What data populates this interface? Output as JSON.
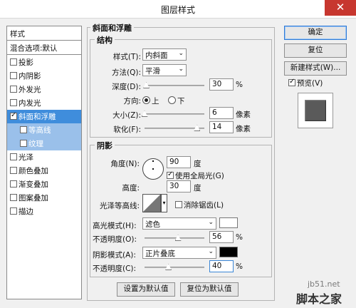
{
  "window": {
    "title": "图层样式",
    "close": "✕"
  },
  "style_list": {
    "header": "样式",
    "blend_options": "混合选项:默认",
    "items": [
      {
        "label": "投影",
        "checked": false
      },
      {
        "label": "内阴影",
        "checked": false
      },
      {
        "label": "外发光",
        "checked": false
      },
      {
        "label": "内发光",
        "checked": false
      },
      {
        "label": "斜面和浮雕",
        "checked": true
      },
      {
        "label": "等高线",
        "checked": false
      },
      {
        "label": "纹理",
        "checked": false
      },
      {
        "label": "光泽",
        "checked": false
      },
      {
        "label": "颜色叠加",
        "checked": false
      },
      {
        "label": "渐变叠加",
        "checked": false
      },
      {
        "label": "图案叠加",
        "checked": false
      },
      {
        "label": "描边",
        "checked": false
      }
    ]
  },
  "bevel": {
    "legend": "斜面和浮雕",
    "structure": {
      "legend": "结构",
      "style_label": "样式(T):",
      "style_value": "内斜面",
      "technique_label": "方法(Q):",
      "technique_value": "平滑",
      "depth_label": "深度(D):",
      "depth_value": "30",
      "depth_unit": "%",
      "depth_level": 0.03,
      "direction_label": "方向:",
      "direction_up": "上",
      "direction_down": "下",
      "direction_selected": "up",
      "size_label": "大小(Z):",
      "size_value": "6",
      "size_unit": "像素",
      "size_level": 0.0,
      "soften_label": "软化(F):",
      "soften_value": "14",
      "soften_unit": "像素",
      "soften_level": 0.88
    },
    "shading": {
      "legend": "阴影",
      "angle_label": "角度(N):",
      "angle_value": "90",
      "angle_unit": "度",
      "global_light_label": "使用全局光(G)",
      "global_light_checked": true,
      "altitude_label": "高度:",
      "altitude_value": "30",
      "altitude_unit": "度",
      "gloss_contour_label": "光泽等高线:",
      "antialiased_label": "消除锯齿(L)",
      "antialiased_checked": false,
      "highlight_mode_label": "高光模式(H):",
      "highlight_mode_value": "滤色",
      "highlight_color": "#ffffff",
      "highlight_opacity_label": "不透明度(O):",
      "highlight_opacity_value": "56",
      "highlight_opacity_level": 0.56,
      "shadow_mode_label": "阴影模式(A):",
      "shadow_mode_value": "正片叠底",
      "shadow_color": "#000000",
      "shadow_opacity_label": "不透明度(C):",
      "shadow_opacity_value": "40",
      "shadow_opacity_level": 0.4,
      "percent": "%"
    },
    "make_default": "设置为默认值",
    "reset_default": "复位为默认值"
  },
  "actions": {
    "ok": "确定",
    "reset": "复位",
    "new_style": "新建样式(W)...",
    "preview_label": "预览(V)",
    "preview_checked": true
  },
  "watermark": {
    "url": "jb51.net",
    "site": "脚本之家"
  }
}
